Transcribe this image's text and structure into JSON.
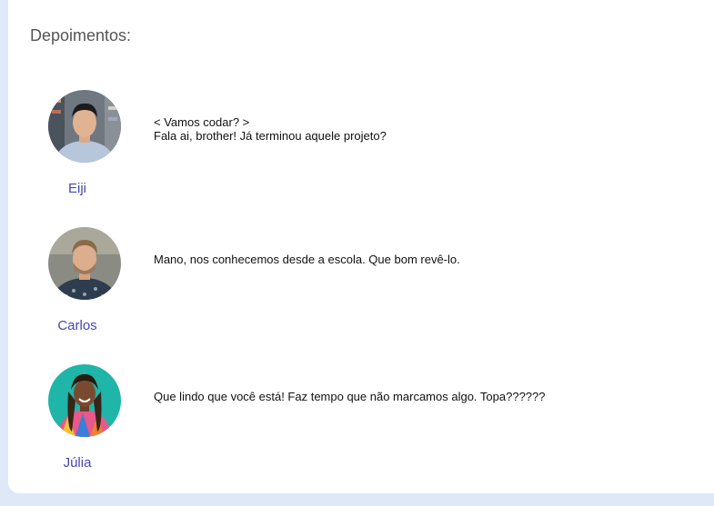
{
  "section": {
    "title": "Depoimentos:"
  },
  "testimonials": [
    {
      "name": "Eiji",
      "lines": [
        "< Vamos codar? >",
        "Fala ai, brother! Já terminou aquele projeto?"
      ]
    },
    {
      "name": "Carlos",
      "lines": [
        "Mano, nos conhecemos desde a escola. Que bom revê-lo."
      ]
    },
    {
      "name": "Júlia",
      "lines": [
        "Que lindo que você está! Faz tempo que não marcamos algo. Topa??????"
      ]
    }
  ],
  "colors": {
    "page_background": "#dfe8f7",
    "card_background": "#ffffff",
    "name_color": "#4646b4",
    "title_color": "#555555"
  }
}
